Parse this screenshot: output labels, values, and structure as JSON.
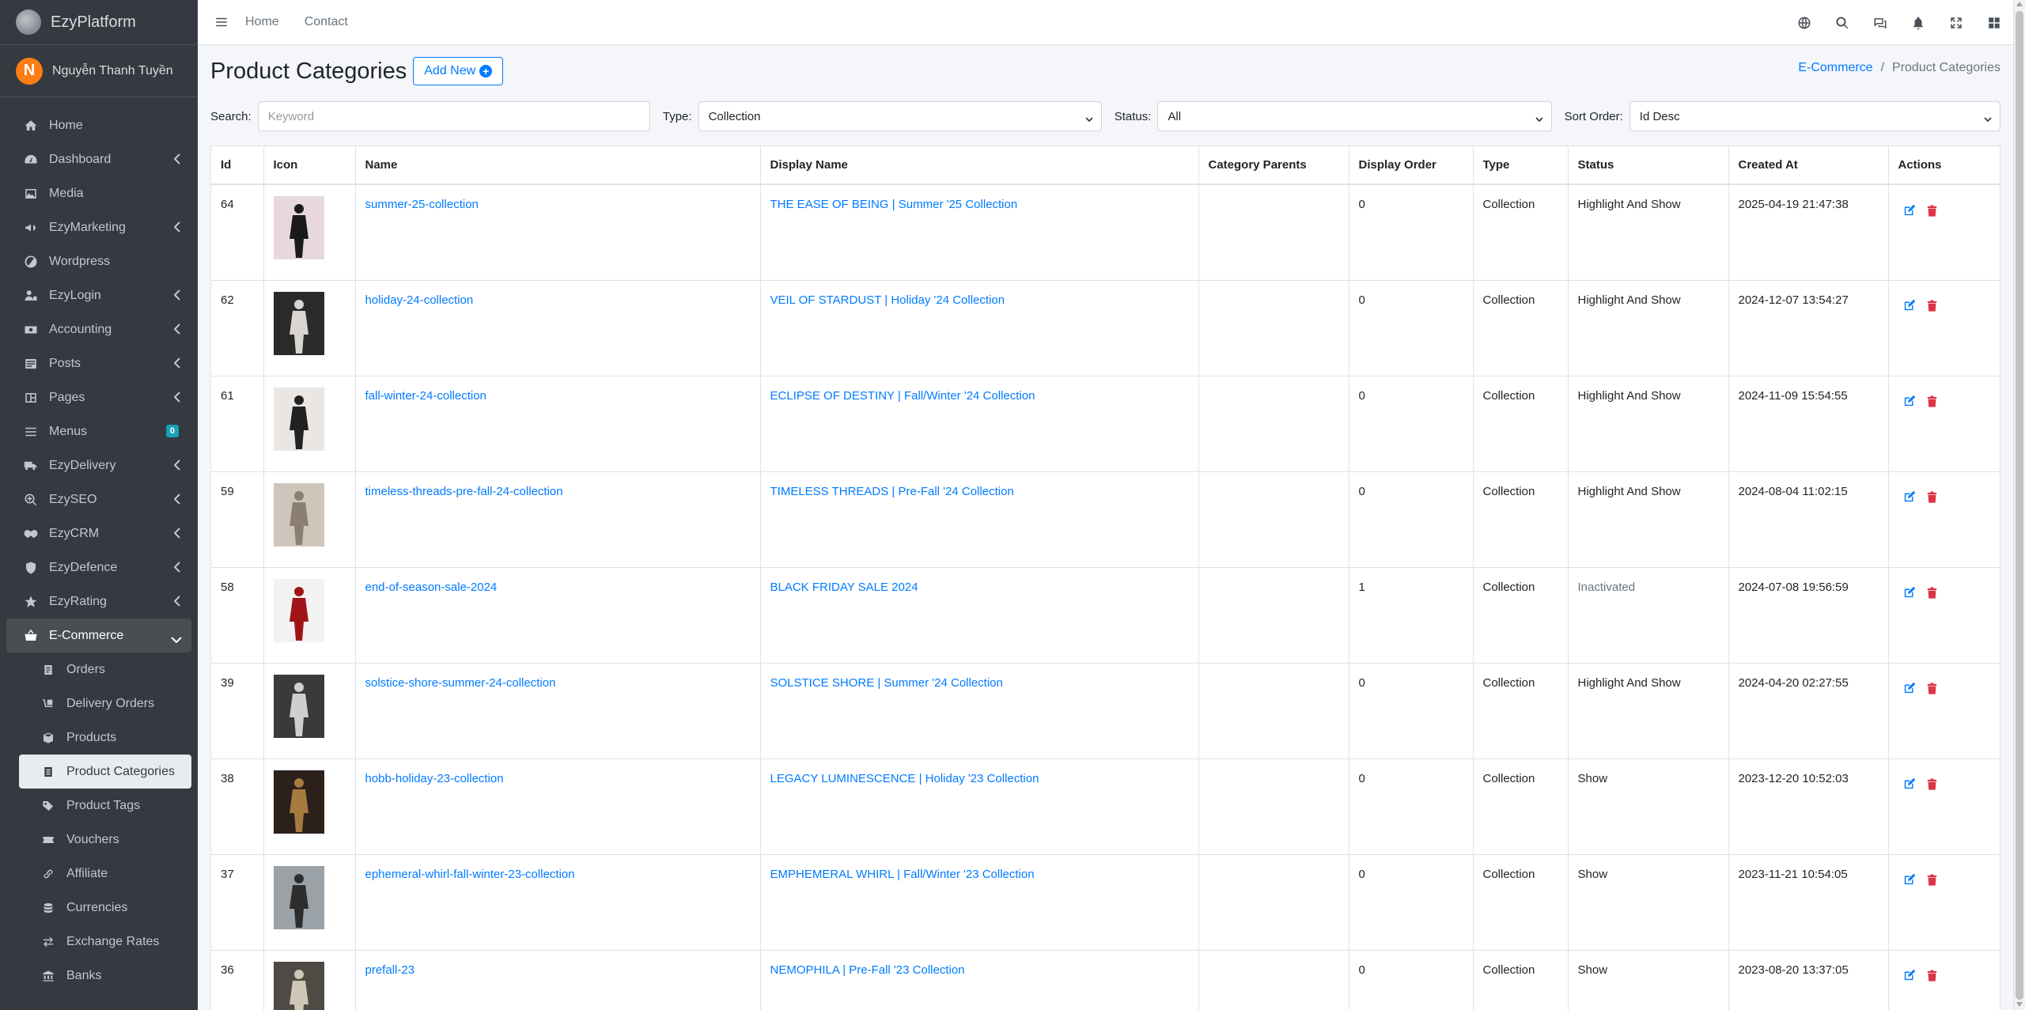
{
  "brand": {
    "name": "EzyPlatform"
  },
  "user": {
    "initial": "N",
    "name": "Nguyễn Thanh Tuyền"
  },
  "sidebar": {
    "items": [
      {
        "label": "Home",
        "icon": "home-icon"
      },
      {
        "label": "Dashboard",
        "icon": "dashboard-icon"
      },
      {
        "label": "Media",
        "icon": "image-icon"
      },
      {
        "label": "EzyMarketing",
        "icon": "megaphone-icon"
      },
      {
        "label": "Wordpress",
        "icon": "wordpress-icon"
      },
      {
        "label": "EzyLogin",
        "icon": "user-lock-icon"
      },
      {
        "label": "Accounting",
        "icon": "money-icon"
      },
      {
        "label": "Posts",
        "icon": "posts-icon"
      },
      {
        "label": "Pages",
        "icon": "pages-icon"
      },
      {
        "label": "Menus",
        "icon": "bars-icon",
        "badge": "0"
      },
      {
        "label": "EzyDelivery",
        "icon": "truck-icon"
      },
      {
        "label": "EzySEO",
        "icon": "search-plus-icon"
      },
      {
        "label": "EzyCRM",
        "icon": "handshake-icon"
      },
      {
        "label": "EzyDefence",
        "icon": "shield-icon"
      },
      {
        "label": "EzyRating",
        "icon": "star-icon"
      },
      {
        "label": "E-Commerce",
        "icon": "basket-icon"
      }
    ],
    "sub_items": [
      {
        "label": "Orders"
      },
      {
        "label": "Delivery Orders"
      },
      {
        "label": "Products"
      },
      {
        "label": "Product Categories"
      },
      {
        "label": "Product Tags"
      },
      {
        "label": "Vouchers"
      },
      {
        "label": "Affiliate"
      },
      {
        "label": "Currencies"
      },
      {
        "label": "Exchange Rates"
      },
      {
        "label": "Banks"
      }
    ]
  },
  "topbar": {
    "home": "Home",
    "contact": "Contact"
  },
  "page": {
    "title": "Product Categories",
    "add_new": "Add New",
    "breadcrumb": {
      "parent": "E-Commerce",
      "separator": "/",
      "current": "Product Categories"
    }
  },
  "filters": {
    "search_label": "Search:",
    "search_placeholder": "Keyword",
    "type_label": "Type:",
    "type_value": "Collection",
    "status_label": "Status:",
    "status_value": "All",
    "sort_label": "Sort Order:",
    "sort_value": "Id Desc"
  },
  "table": {
    "headers": [
      "Id",
      "Icon",
      "Name",
      "Display Name",
      "Category Parents",
      "Display Order",
      "Type",
      "Status",
      "Created At",
      "Actions"
    ],
    "rows": [
      {
        "id": "64",
        "name": "summer-25-collection",
        "display_name": "THE EASE OF BEING | Summer '25 Collection",
        "parents": "",
        "order": "0",
        "type": "Collection",
        "status": "Highlight And Show",
        "created": "2025-04-19 21:47:38"
      },
      {
        "id": "62",
        "name": "holiday-24-collection",
        "display_name": "VEIL OF STARDUST | Holiday '24 Collection",
        "parents": "",
        "order": "0",
        "type": "Collection",
        "status": "Highlight And Show",
        "created": "2024-12-07 13:54:27"
      },
      {
        "id": "61",
        "name": "fall-winter-24-collection",
        "display_name": "ECLIPSE OF DESTINY | Fall/Winter '24 Collection",
        "parents": "",
        "order": "0",
        "type": "Collection",
        "status": "Highlight And Show",
        "created": "2024-11-09 15:54:55"
      },
      {
        "id": "59",
        "name": "timeless-threads-pre-fall-24-collection",
        "display_name": "TIMELESS THREADS | Pre-Fall '24 Collection",
        "parents": "",
        "order": "0",
        "type": "Collection",
        "status": "Highlight And Show",
        "created": "2024-08-04 11:02:15"
      },
      {
        "id": "58",
        "name": "end-of-season-sale-2024",
        "display_name": "BLACK FRIDAY SALE 2024",
        "parents": "",
        "order": "1",
        "type": "Collection",
        "status": "Inactivated",
        "created": "2024-07-08 19:56:59"
      },
      {
        "id": "39",
        "name": "solstice-shore-summer-24-collection",
        "display_name": "SOLSTICE SHORE | Summer '24 Collection",
        "parents": "",
        "order": "0",
        "type": "Collection",
        "status": "Highlight And Show",
        "created": "2024-04-20 02:27:55"
      },
      {
        "id": "38",
        "name": "hobb-holiday-23-collection",
        "display_name": "LEGACY LUMINESCENCE | Holiday '23 Collection",
        "parents": "",
        "order": "0",
        "type": "Collection",
        "status": "Show",
        "created": "2023-12-20 10:52:03"
      },
      {
        "id": "37",
        "name": "ephemeral-whirl-fall-winter-23-collection",
        "display_name": "EMPHEMERAL WHIRL | Fall/Winter '23 Collection",
        "parents": "",
        "order": "0",
        "type": "Collection",
        "status": "Show",
        "created": "2023-11-21 10:54:05"
      },
      {
        "id": "36",
        "name": "prefall-23",
        "display_name": "NEMOPHILA | Pre-Fall '23 Collection",
        "parents": "",
        "order": "0",
        "type": "Collection",
        "status": "Show",
        "created": "2023-08-20 13:37:05"
      }
    ]
  },
  "colors": {
    "sidebar": "#343a40",
    "link": "#007bff",
    "danger": "#dc3545",
    "badge": "#17a2b8",
    "avatar": "#fd7e14"
  }
}
